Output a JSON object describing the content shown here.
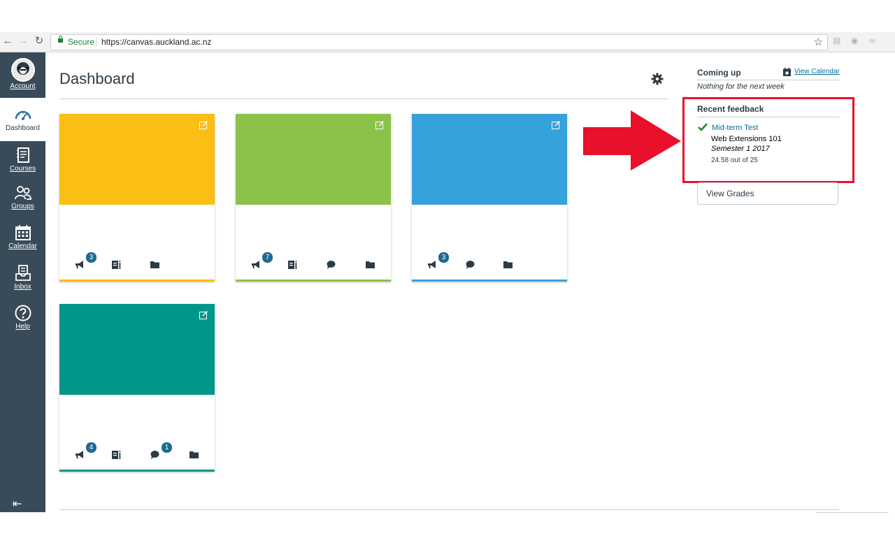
{
  "browser": {
    "secure_label": "Secure",
    "url": "https://canvas.auckland.ac.nz"
  },
  "sidebar": {
    "items": [
      {
        "label": "Account",
        "icon": "account-avatar"
      },
      {
        "label": "Dashboard",
        "icon": "dashboard-icon",
        "active": true
      },
      {
        "label": "Courses",
        "icon": "courses-icon"
      },
      {
        "label": "Groups",
        "icon": "groups-icon"
      },
      {
        "label": "Calendar",
        "icon": "calendar-icon"
      },
      {
        "label": "Inbox",
        "icon": "inbox-icon"
      },
      {
        "label": "Help",
        "icon": "help-icon"
      }
    ],
    "collapse_icon": "collapse-nav-icon"
  },
  "main": {
    "title": "Dashboard",
    "cards": [
      {
        "color": "#fbbe14",
        "announcements_badge": "3",
        "actions": [
          "announcements",
          "assignments",
          "files"
        ]
      },
      {
        "color": "#8bc34a",
        "announcements_badge": "7",
        "actions": [
          "announcements",
          "assignments",
          "discussions",
          "files"
        ]
      },
      {
        "color": "#36a2dc",
        "announcements_badge": "3",
        "actions": [
          "announcements",
          "discussions",
          "files"
        ]
      },
      {
        "color": "#00978a",
        "announcements_badge": "4",
        "discussions_badge": "1",
        "actions": [
          "announcements",
          "assignments",
          "discussions",
          "files"
        ]
      }
    ]
  },
  "coming_up": {
    "title": "Coming up",
    "view_calendar": "View Calendar",
    "empty_text": "Nothing for the next week"
  },
  "recent_feedback": {
    "title": "Recent feedback",
    "item": {
      "assignment": "Mid-term Test",
      "course": "Web Extensions 101",
      "term": "Semester 1 2017",
      "score": "24.58 out of 25"
    }
  },
  "view_grades_label": "View Grades",
  "colors": {
    "sidebar": "#394b58",
    "link": "#0770a3",
    "highlight": "#e8102a",
    "badge": "#1e6a94"
  }
}
